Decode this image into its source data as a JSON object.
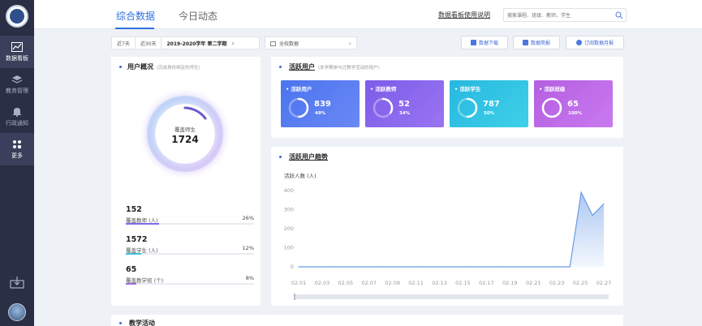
{
  "sidebar": {
    "items": [
      {
        "label": "数据看板",
        "icon": "chart-icon",
        "active": true
      },
      {
        "label": "教务管理",
        "icon": "layers-icon",
        "active": false
      },
      {
        "label": "行政通知",
        "icon": "bell-icon",
        "active": false
      },
      {
        "label": "更多",
        "icon": "grid-icon",
        "active": false
      }
    ],
    "bottom_icon": "download-icon"
  },
  "header": {
    "tabs": [
      {
        "label": "综合数据",
        "active": true
      },
      {
        "label": "今日动态",
        "active": false
      }
    ],
    "help_link": "数据看板使用说明",
    "search_placeholder": "搜索课程、班级、教师、学生"
  },
  "filters": {
    "range_7": "近7天",
    "range_30": "近30天",
    "term": "2019-2020学年 第二学期",
    "scope": "全校数据"
  },
  "actions": [
    "数据下载",
    "数据简报",
    "订阅数据月报"
  ],
  "user_overview": {
    "title": "用户概况",
    "subtitle": "(完成身份绑定的师生)",
    "ring_label": "覆盖师生",
    "ring_value": "1724",
    "stats": [
      {
        "value": "152",
        "label": "覆盖教师 (人)",
        "percent": "26%",
        "fill": 0.26,
        "color": "#7b6cf0"
      },
      {
        "value": "1572",
        "label": "覆盖学生 (人)",
        "percent": "12%",
        "fill": 0.12,
        "color": "#38c2d6"
      },
      {
        "value": "65",
        "label": "覆盖教学班 (个)",
        "percent": "8%",
        "fill": 0.08,
        "color": "#a56be0"
      }
    ]
  },
  "active_users": {
    "title": "活跃用户",
    "subtitle": "(本学期参与过教学活动的用户)",
    "tiles": [
      {
        "label": "活跃用户",
        "value": "839",
        "percent": "49%",
        "fill": 0.49,
        "color_from": "#4b74ee",
        "color_to": "#6a88f5"
      },
      {
        "label": "活跃教师",
        "value": "52",
        "percent": "34%",
        "fill": 0.34,
        "color_from": "#7c5de8",
        "color_to": "#9a74f2"
      },
      {
        "label": "活跃学生",
        "value": "787",
        "percent": "50%",
        "fill": 0.5,
        "color_from": "#27b8e0",
        "color_to": "#3fd0e8"
      },
      {
        "label": "活跃班级",
        "value": "65",
        "percent": "100%",
        "fill": 1.0,
        "color_from": "#b45ee0",
        "color_to": "#c97af0"
      }
    ]
  },
  "trend": {
    "title": "活跃用户趋势",
    "ylabel": "活跃人数 (人)"
  },
  "chart_data": {
    "type": "area",
    "title": "活跃用户趋势",
    "ylabel": "活跃人数 (人)",
    "xlabel": "",
    "x_ticks": [
      "02.01",
      "02.03",
      "02.05",
      "02.07",
      "02.09",
      "02.11",
      "02.13",
      "02.15",
      "02.17",
      "02.19",
      "02.21",
      "02.23",
      "02.25",
      "02.27"
    ],
    "y_ticks": [
      0,
      100,
      200,
      300,
      400
    ],
    "ylim": [
      0,
      400
    ],
    "x": [
      "02.01",
      "02.02",
      "02.03",
      "02.04",
      "02.05",
      "02.06",
      "02.07",
      "02.08",
      "02.09",
      "02.10",
      "02.11",
      "02.12",
      "02.13",
      "02.14",
      "02.15",
      "02.16",
      "02.17",
      "02.18",
      "02.19",
      "02.20",
      "02.21",
      "02.22",
      "02.23",
      "02.24",
      "02.25",
      "02.26",
      "02.27",
      "02.28"
    ],
    "values": [
      0,
      0,
      0,
      0,
      0,
      0,
      0,
      0,
      0,
      0,
      0,
      0,
      0,
      0,
      0,
      0,
      0,
      0,
      0,
      0,
      0,
      0,
      0,
      0,
      0,
      390,
      270,
      330
    ],
    "color": "#6a9ae8",
    "grid": false
  },
  "next_section": {
    "title": "教学活动"
  }
}
